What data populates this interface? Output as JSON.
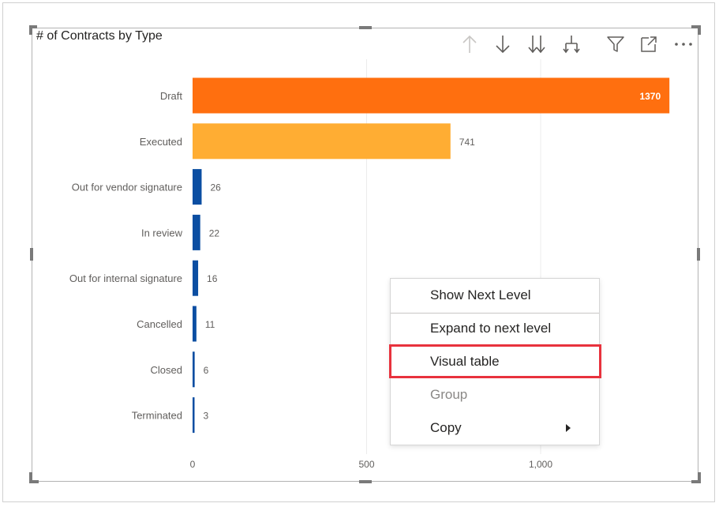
{
  "visual": {
    "title": "# of Contracts by Type"
  },
  "toolbar": {
    "icons": [
      "drill-up-icon",
      "drill-down-icon",
      "expand-all-down-icon",
      "expand-hierarchy-icon",
      "filter-icon",
      "focus-mode-icon",
      "more-options-icon"
    ]
  },
  "chart_data": {
    "type": "bar",
    "orientation": "horizontal",
    "title": "# of Contracts by Type",
    "categories": [
      "Draft",
      "Executed",
      "Out for vendor signature",
      "In review",
      "Out for internal signature",
      "Cancelled",
      "Closed",
      "Terminated"
    ],
    "values": [
      1370,
      741,
      26,
      22,
      16,
      11,
      6,
      3
    ],
    "data_labels": [
      "1370",
      "741",
      "26",
      "22",
      "16",
      "11",
      "6",
      "3"
    ],
    "colors": [
      "#ff6f0f",
      "#ffad33",
      "#0b4ea2",
      "#0b4ea2",
      "#0b4ea2",
      "#0b4ea2",
      "#0b4ea2",
      "#0b4ea2"
    ],
    "x_ticks": [
      0,
      500,
      1000
    ],
    "x_tick_labels": [
      "0",
      "500",
      "1,000"
    ],
    "xlim": [
      0,
      1370
    ],
    "grid": true
  },
  "context_menu": {
    "items": [
      {
        "label": "Show Next Level",
        "enabled": true
      },
      {
        "label": "Expand to next level",
        "enabled": true
      },
      {
        "label": "Visual table",
        "enabled": true,
        "highlighted": true
      },
      {
        "label": "Group",
        "enabled": false
      },
      {
        "label": "Copy",
        "enabled": true,
        "has_submenu": true
      }
    ],
    "highlight_color": "#e8323d"
  }
}
